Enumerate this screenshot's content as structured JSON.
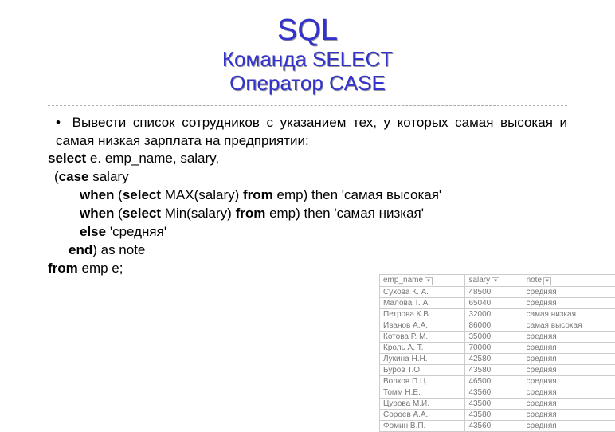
{
  "title": {
    "line1": "SQL",
    "line2": "Команда SELECT",
    "line3": "Оператор CASE"
  },
  "intro": {
    "text": "Вывести список сотрудников с указанием тех, у которых самая высокая и самая низкая зарплата на предприятии:"
  },
  "code": {
    "l1_kw": "select",
    "l1_rest": " e. emp_name, salary,",
    "l2_a": " (",
    "l2_kw": "case",
    "l2_b": " salary",
    "l3_a": "when",
    "l3_b": " (",
    "l3_c": "select",
    "l3_d": " MAX(salary) ",
    "l3_e": "from",
    "l3_f": " emp) then 'самая высокая'",
    "l4_a": "when",
    "l4_b": " (",
    "l4_c": "select",
    "l4_d": " Min(salary) ",
    "l4_e": "from",
    "l4_f": " emp) then 'самая низкая'",
    "l5_a": "else",
    "l5_b": " 'средняя'",
    "l6_a": "end",
    "l6_b": ")  as note",
    "l7_a": "from",
    "l7_b": " emp e;"
  },
  "table": {
    "headers": [
      "emp_name",
      "salary",
      "note"
    ],
    "rows": [
      [
        "Сухова К. А.",
        "48500",
        "средняя"
      ],
      [
        "Малова Т. А.",
        "65040",
        "средняя"
      ],
      [
        "Петрова К.В.",
        "32000",
        "самая низкая"
      ],
      [
        "Иванов А.А.",
        "86000",
        "самая высокая"
      ],
      [
        "Котова Р. М.",
        "35000",
        "средняя"
      ],
      [
        "Кроль А. Т.",
        "70000",
        "средняя"
      ],
      [
        "Лукина Н.Н.",
        "42580",
        "средняя"
      ],
      [
        "Буров Т.О.",
        "43580",
        "средняя"
      ],
      [
        "Волков П.Ц.",
        "46500",
        "средняя"
      ],
      [
        "Томм Н.Е.",
        "43560",
        "средняя"
      ],
      [
        "Цурова М.И.",
        "43500",
        "средняя"
      ],
      [
        "Сороев А.А.",
        "43580",
        "средняя"
      ],
      [
        "Фомин В.П.",
        "43560",
        "средняя"
      ]
    ]
  }
}
